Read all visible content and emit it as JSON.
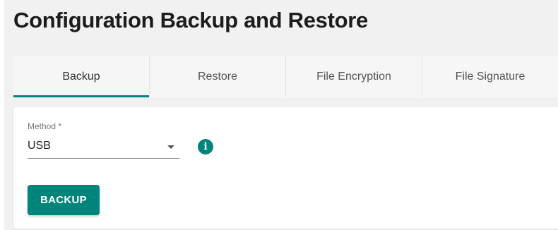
{
  "page": {
    "title": "Configuration Backup and Restore"
  },
  "tabs": [
    {
      "label": "Backup",
      "active": true
    },
    {
      "label": "Restore",
      "active": false
    },
    {
      "label": "File Encryption",
      "active": false
    },
    {
      "label": "File Signature",
      "active": false
    }
  ],
  "form": {
    "method_label": "Method *",
    "method_value": "USB",
    "info_icon": "info-icon",
    "dropdown_icon": "chevron-down-icon"
  },
  "actions": {
    "backup_label": "BACKUP"
  },
  "colors": {
    "accent": "#00857a",
    "background": "#f1f1f1",
    "card": "#ffffff"
  }
}
